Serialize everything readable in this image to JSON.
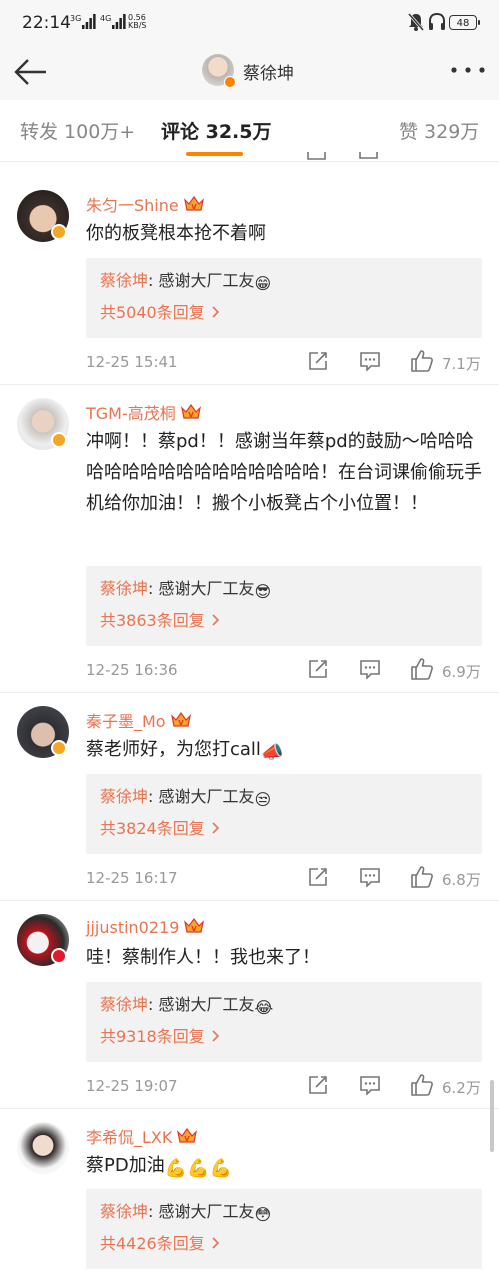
{
  "status_bar": {
    "time": "22:14",
    "signal1": "3G",
    "signal2": "4G",
    "speed_value": "0.56",
    "speed_unit": "KB/S",
    "battery": "48"
  },
  "nav": {
    "title": "蔡徐坤"
  },
  "tabs": [
    {
      "label": "转发 100万+"
    },
    {
      "label": "评论 32.5万"
    },
    {
      "label": "赞 329万"
    }
  ],
  "comments": [
    {
      "user": "朱匀一Shine",
      "text": "你的板凳根本抢不着啊",
      "reply_author": "蔡徐坤",
      "reply_text": ": 感谢大厂工友",
      "reply_emoji": "😁",
      "reply_count": "共5040条回复",
      "time": "12-25 15:41",
      "likes": "7.1万"
    },
    {
      "user": "TGM-高茂桐",
      "text": "冲啊！！蔡pd！！感谢当年蔡pd的鼓励～哈哈哈哈哈哈哈哈哈哈哈哈哈哈哈哈！在台词课偷偷玩手机给你加油！！搬个小板凳占个小位置！！",
      "reply_author": "蔡徐坤",
      "reply_text": ": 感谢大厂工友",
      "reply_emoji": "😎",
      "reply_count": "共3863条回复",
      "time": "12-25 16:36",
      "likes": "6.9万"
    },
    {
      "user": "秦子墨_Mo",
      "text": "蔡老师好，为您打call",
      "text_emoji": "📣",
      "reply_author": "蔡徐坤",
      "reply_text": ": 感谢大厂工友",
      "reply_emoji": "😒",
      "reply_count": "共3824条回复",
      "time": "12-25 16:17",
      "likes": "6.8万"
    },
    {
      "user": "jjjustin0219",
      "text": "哇！蔡制作人！！我也来了！",
      "reply_author": "蔡徐坤",
      "reply_text": ": 感谢大厂工友",
      "reply_emoji": "😂",
      "reply_count": "共9318条回复",
      "time": "12-25 19:07",
      "likes": "6.2万"
    },
    {
      "user": "李希侃_LXK",
      "text": "蔡PD加油",
      "text_emoji": "💪💪💪",
      "reply_author": "蔡徐坤",
      "reply_text": ": 感谢大厂工友",
      "reply_emoji": "😳",
      "reply_count": "共4426条回复"
    }
  ],
  "icons": {
    "back": "back-arrow-icon",
    "more": "more-dots-icon",
    "share": "share-icon",
    "comment": "comment-icon",
    "like": "thumbs-up-icon",
    "crown": "vip-crown-icon",
    "verified": "verified-badge-icon"
  },
  "colors": {
    "accent": "#ff8200",
    "username": "#eb7350",
    "meta": "#999999",
    "reply_bg": "#f2f2f2"
  }
}
